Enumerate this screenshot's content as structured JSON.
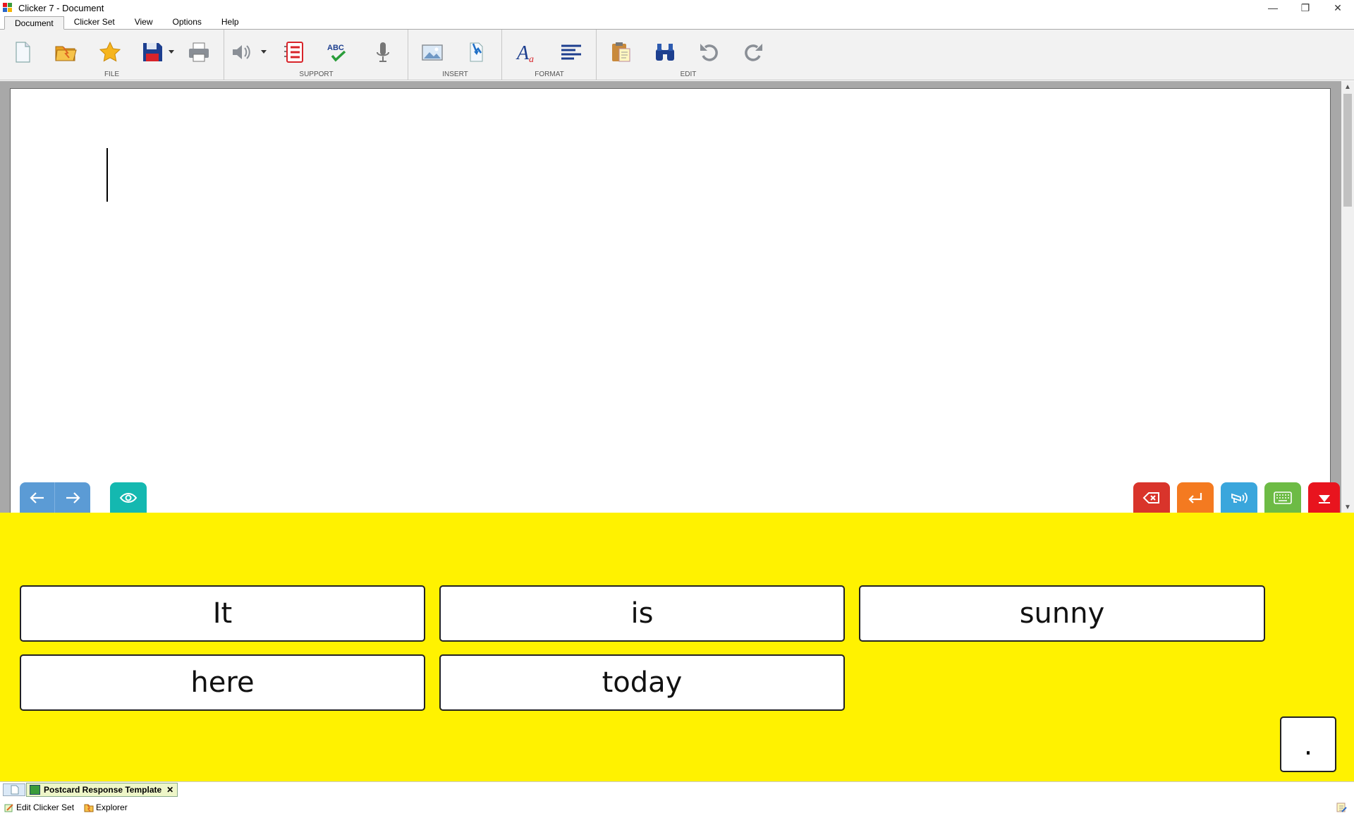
{
  "window": {
    "title": "Clicker 7 - Document",
    "minimize": "—",
    "restore": "❐",
    "close": "✕"
  },
  "menu": {
    "tabs": [
      "Document",
      "Clicker Set",
      "View",
      "Options",
      "Help"
    ]
  },
  "ribbon": {
    "groups": [
      "FILE",
      "SUPPORT",
      "INSERT",
      "FORMAT",
      "EDIT"
    ]
  },
  "grid": {
    "cells": [
      "It",
      "is",
      "sunny",
      "here",
      "today"
    ],
    "punctuation": "."
  },
  "tabs": {
    "clicker_set": "Postcard Response Template",
    "close": "✕"
  },
  "status": {
    "edit_clicker_set": "Edit Clicker Set",
    "explorer": "Explorer"
  },
  "colors": {
    "grid_background": "#fff200",
    "nav_blue": "#5b9bd5",
    "eye_teal": "#14b8b0",
    "backspace_red": "#d9342b",
    "enter_orange": "#f47a20",
    "speak_blue": "#3aa6dc",
    "keyboard_green": "#6dbb45",
    "hide_red": "#e8141e"
  }
}
